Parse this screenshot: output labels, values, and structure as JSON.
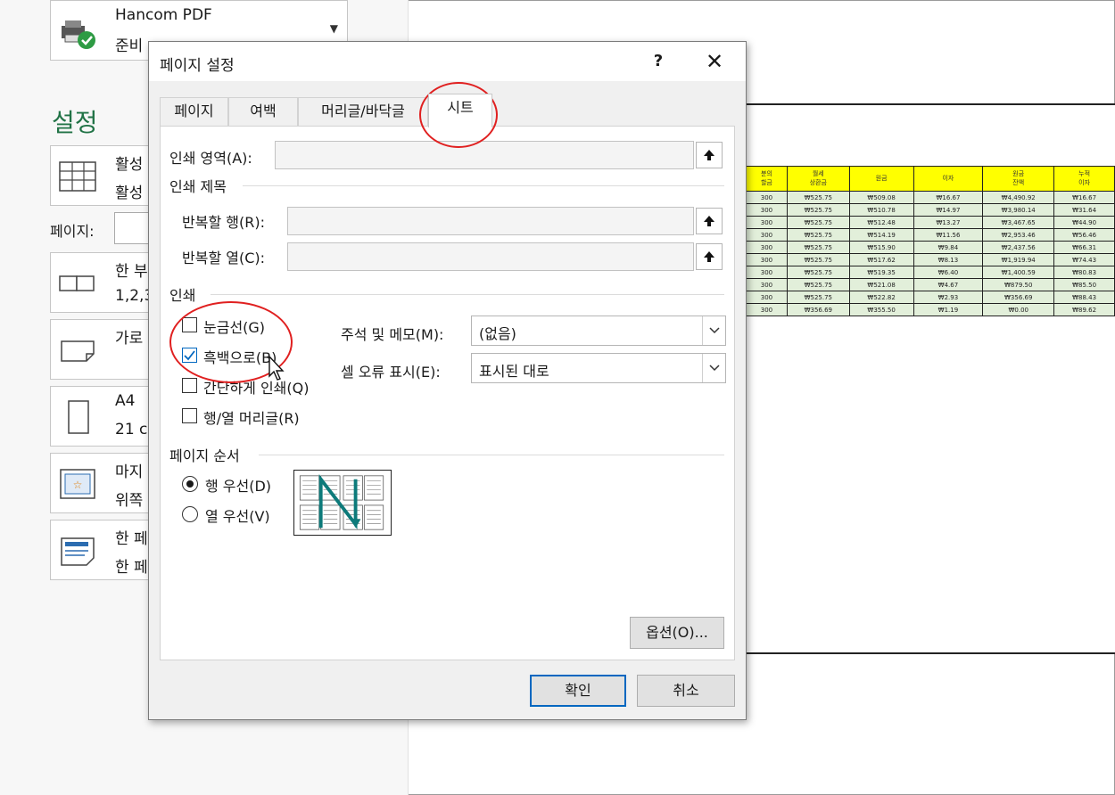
{
  "background": {
    "printer": {
      "name": "Hancom PDF",
      "status": "준비"
    },
    "settings_title": "설정",
    "rows": [
      {
        "l1": "활성",
        "l2": "활성"
      },
      {
        "l1": "한 부",
        "l2": "1,2,3"
      },
      {
        "l1": "가로",
        "l2": ""
      },
      {
        "l1": "A4",
        "l2": "21 c"
      },
      {
        "l1": "마지",
        "l2": "위쪽"
      },
      {
        "l1": "한 페",
        "l2": "한 페"
      }
    ],
    "pages_label": "페이지:",
    "preview": {
      "headers": [
        "분의\n할금",
        "월세\n상환금",
        "원금",
        "이자",
        "원금\n잔액",
        "누적\n이자"
      ],
      "rows": [
        [
          "300",
          "₩525.75",
          "₩509.08",
          "₩16.67",
          "₩4,490.92",
          "₩16.67"
        ],
        [
          "300",
          "₩525.75",
          "₩510.78",
          "₩14.97",
          "₩3,980.14",
          "₩31.64"
        ],
        [
          "300",
          "₩525.75",
          "₩512.48",
          "₩13.27",
          "₩3,467.65",
          "₩44.90"
        ],
        [
          "300",
          "₩525.75",
          "₩514.19",
          "₩11.56",
          "₩2,953.46",
          "₩56.46"
        ],
        [
          "300",
          "₩525.75",
          "₩515.90",
          "₩9.84",
          "₩2,437.56",
          "₩66.31"
        ],
        [
          "300",
          "₩525.75",
          "₩517.62",
          "₩8.13",
          "₩1,919.94",
          "₩74.43"
        ],
        [
          "300",
          "₩525.75",
          "₩519.35",
          "₩6.40",
          "₩1,400.59",
          "₩80.83"
        ],
        [
          "300",
          "₩525.75",
          "₩521.08",
          "₩4.67",
          "₩879.50",
          "₩85.50"
        ],
        [
          "300",
          "₩525.75",
          "₩522.82",
          "₩2.93",
          "₩356.69",
          "₩88.43"
        ],
        [
          "300",
          "₩356.69",
          "₩355.50",
          "₩1.19",
          "₩0.00",
          "₩89.62"
        ]
      ]
    }
  },
  "dialog": {
    "title": "페이지 설정",
    "help": "?",
    "close": "✕",
    "tabs": [
      "페이지",
      "여백",
      "머리글/바닥글",
      "시트"
    ],
    "print_area_label": "인쇄 영역(A):",
    "print_titles_group": "인쇄 제목",
    "repeat_rows_label": "반복할 행(R):",
    "repeat_cols_label": "반복할 열(C):",
    "print_group": "인쇄",
    "gridlines_label": "눈금선(G)",
    "bw_label": "흑백으로(B)",
    "draft_label": "간단하게 인쇄(Q)",
    "headings_label": "행/열 머리글(R)",
    "comments_label": "주석 및 메모(M):",
    "comments_value": "(없음)",
    "errors_label": "셀 오류 표시(E):",
    "errors_value": "표시된 대로",
    "page_order_group": "페이지 순서",
    "down_then_over": "행 우선(D)",
    "over_then_down": "열 우선(V)",
    "options_button": "옵션(O)...",
    "ok_button": "확인",
    "cancel_button": "취소"
  },
  "colors": {
    "annotation": "#e02020",
    "accent": "#0067c0",
    "excel_green": "#217346"
  }
}
